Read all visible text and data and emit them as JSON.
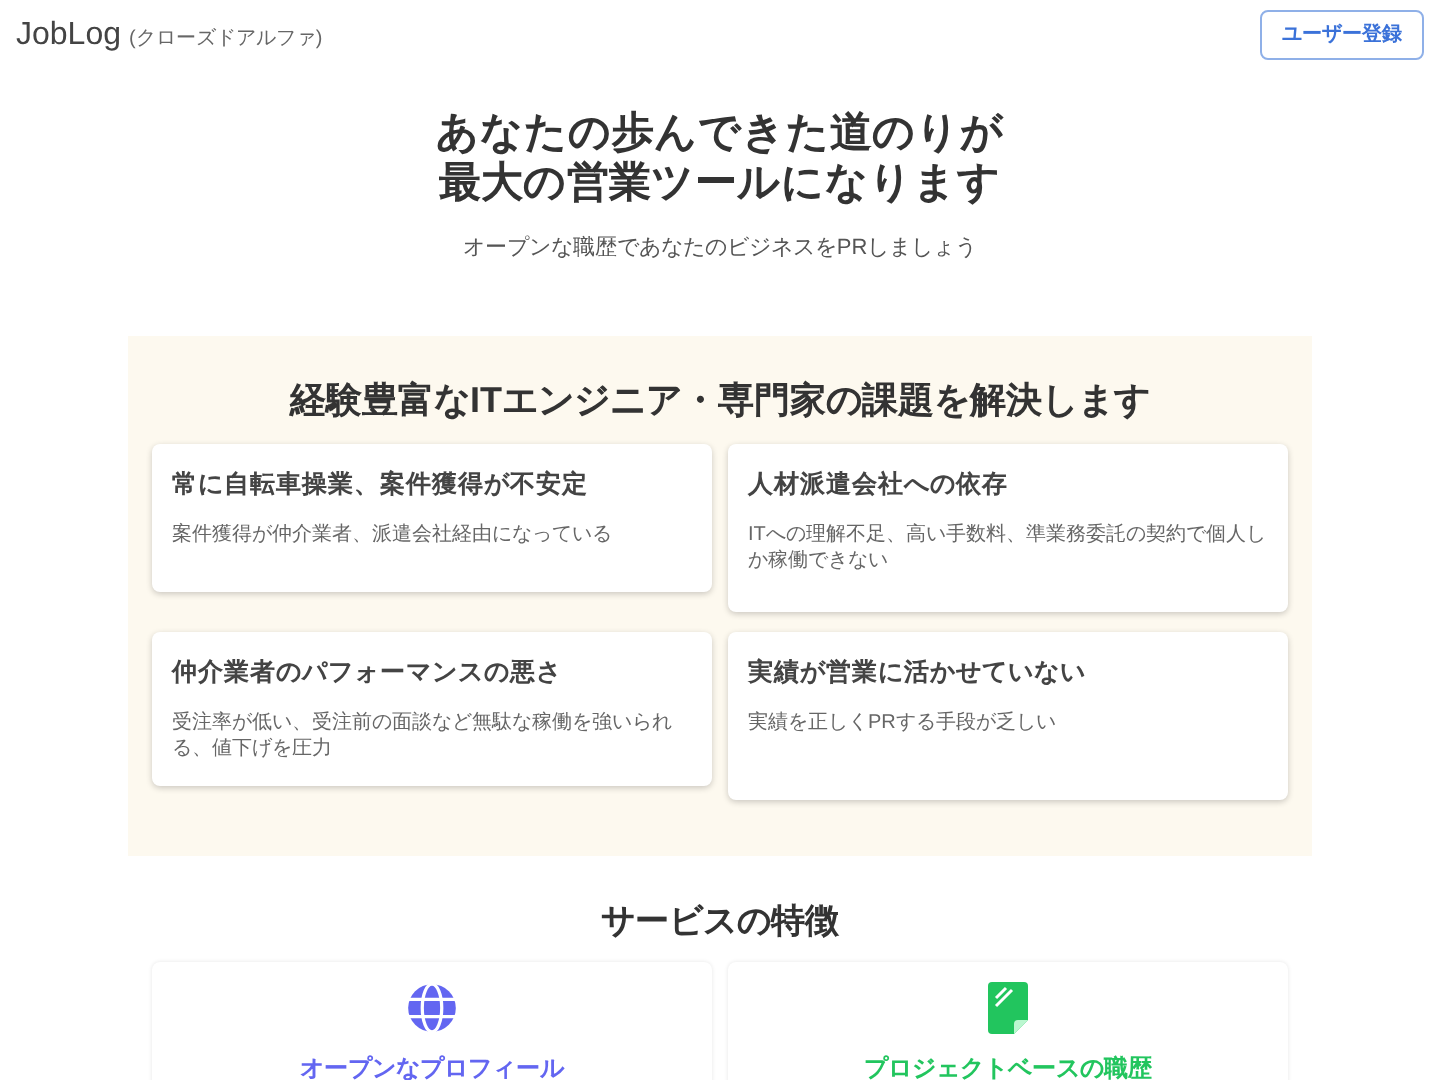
{
  "header": {
    "logo": "JobLog",
    "badge": "(クローズドアルファ)",
    "signup_button": "ユーザー登録"
  },
  "hero": {
    "title_lines": [
      "あなたの歩んできた道のりが",
      "最大の営業ツールになります"
    ],
    "subtitle": "オープンな職歴であなたのビジネスをPRしましょう"
  },
  "problems": {
    "title": "経験豊富なITエンジニア・専門家の課題を解決します",
    "items": [
      {
        "title": "常に自転車操業、案件獲得が不安定",
        "text": "案件獲得が仲介業者、派遣会社経由になっている"
      },
      {
        "title": "人材派遣会社への依存",
        "text": "ITへの理解不足、高い手数料、準業務委託の契約で個人しか稼働できない"
      },
      {
        "title": "仲介業者のパフォーマンスの悪さ",
        "text": "受注率が低い、受注前の面談など無駄な稼働を強いられる、値下げを圧力"
      },
      {
        "title": "実績が営業に活かせていない",
        "text": "実績を正しくPRする手段が乏しい"
      }
    ]
  },
  "features": {
    "title": "サービスの特徴",
    "items": [
      {
        "kind": "globe",
        "title": "オープンなプロフィール",
        "color": "#6366f1"
      },
      {
        "kind": "document",
        "title": "プロジェクトベースの職歴",
        "color": "#22c55e"
      }
    ]
  }
}
